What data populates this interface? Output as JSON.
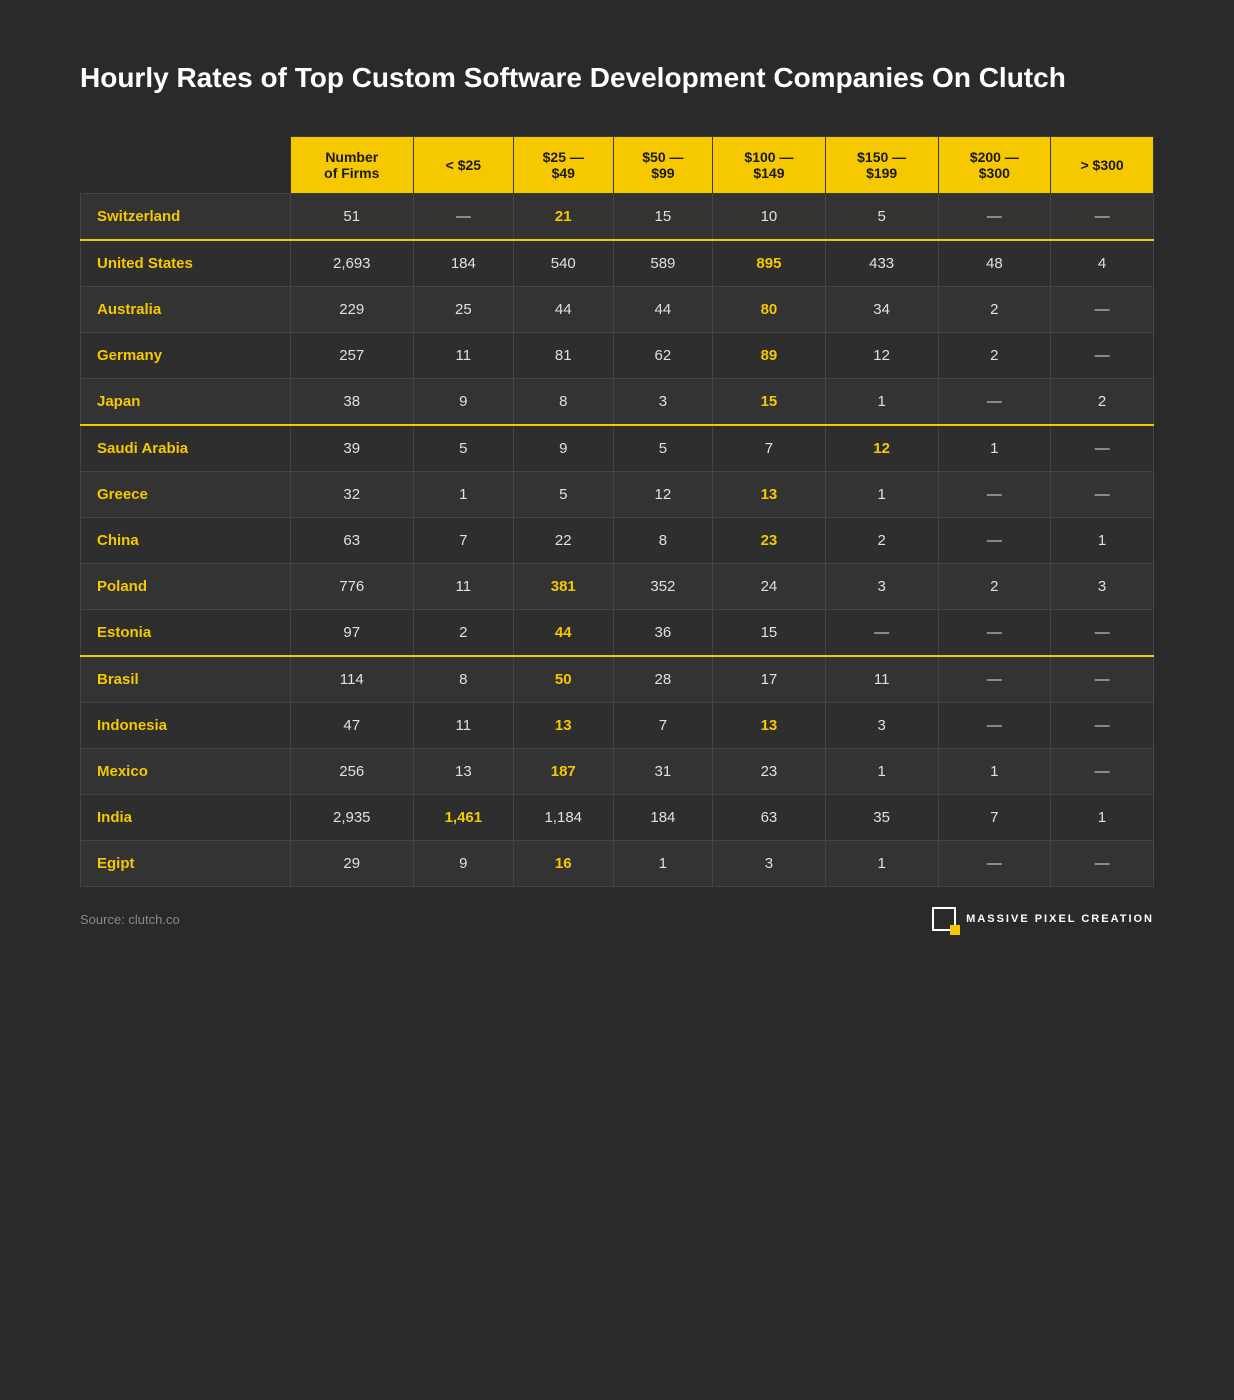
{
  "title": "Hourly Rates of Top Custom Software Development Companies On Clutch",
  "headers": [
    {
      "key": "country",
      "label": ""
    },
    {
      "key": "firms",
      "label": "Number of Firms"
    },
    {
      "key": "lt25",
      "label": "< $25"
    },
    {
      "key": "25to49",
      "label": "$25 — $49"
    },
    {
      "key": "50to99",
      "label": "$50 — $99"
    },
    {
      "key": "100to149",
      "label": "$100 — $149"
    },
    {
      "key": "150to199",
      "label": "$150 — $199"
    },
    {
      "key": "200to300",
      "label": "$200 — $300"
    },
    {
      "key": "gt300",
      "label": "> $300"
    }
  ],
  "rows": [
    {
      "country": "Switzerland",
      "firms": "51",
      "lt25": "—",
      "25to49": "21",
      "50to99": "15",
      "100to149": "10",
      "150to199": "5",
      "200to300": "—",
      "gt300": "—",
      "bold": "25to49",
      "separator": true
    },
    {
      "country": "United States",
      "firms": "2,693",
      "lt25": "184",
      "25to49": "540",
      "50to99": "589",
      "100to149": "895",
      "150to199": "433",
      "200to300": "48",
      "gt300": "4",
      "bold": "100to149",
      "separator": false
    },
    {
      "country": "Australia",
      "firms": "229",
      "lt25": "25",
      "25to49": "44",
      "50to99": "44",
      "100to149": "80",
      "150to199": "34",
      "200to300": "2",
      "gt300": "—",
      "bold": "100to149",
      "separator": false
    },
    {
      "country": "Germany",
      "firms": "257",
      "lt25": "11",
      "25to49": "81",
      "50to99": "62",
      "100to149": "89",
      "150to199": "12",
      "200to300": "2",
      "gt300": "—",
      "bold": "100to149",
      "separator": false
    },
    {
      "country": "Japan",
      "firms": "38",
      "lt25": "9",
      "25to49": "8",
      "50to99": "3",
      "100to149": "15",
      "150to199": "1",
      "200to300": "—",
      "gt300": "2",
      "bold": "100to149",
      "separator": true
    },
    {
      "country": "Saudi Arabia",
      "firms": "39",
      "lt25": "5",
      "25to49": "9",
      "50to99": "5",
      "100to149": "7",
      "150to199": "12",
      "200to300": "1",
      "gt300": "—",
      "bold": "150to199",
      "separator": false
    },
    {
      "country": "Greece",
      "firms": "32",
      "lt25": "1",
      "25to49": "5",
      "50to99": "12",
      "100to149": "13",
      "150to199": "1",
      "200to300": "—",
      "gt300": "—",
      "bold": "100to149",
      "separator": false
    },
    {
      "country": "China",
      "firms": "63",
      "lt25": "7",
      "25to49": "22",
      "50to99": "8",
      "100to149": "23",
      "150to199": "2",
      "200to300": "—",
      "gt300": "1",
      "bold": "100to149",
      "separator": false
    },
    {
      "country": "Poland",
      "firms": "776",
      "lt25": "11",
      "25to49": "381",
      "50to99": "352",
      "100to149": "24",
      "150to199": "3",
      "200to300": "2",
      "gt300": "3",
      "bold": "25to49",
      "separator": false
    },
    {
      "country": "Estonia",
      "firms": "97",
      "lt25": "2",
      "25to49": "44",
      "50to99": "36",
      "100to149": "15",
      "150to199": "—",
      "200to300": "—",
      "gt300": "—",
      "bold": "25to49",
      "separator": true
    },
    {
      "country": "Brasil",
      "firms": "114",
      "lt25": "8",
      "25to49": "50",
      "50to99": "28",
      "100to149": "17",
      "150to199": "11",
      "200to300": "—",
      "gt300": "—",
      "bold": "25to49",
      "separator": false
    },
    {
      "country": "Indonesia",
      "firms": "47",
      "lt25": "11",
      "25to49": "13",
      "50to99": "7",
      "100to149": "13",
      "150to199": "3",
      "200to300": "—",
      "gt300": "—",
      "bold": "25to49,100to149",
      "separator": false
    },
    {
      "country": "Mexico",
      "firms": "256",
      "lt25": "13",
      "25to49": "187",
      "50to99": "31",
      "100to149": "23",
      "150to199": "1",
      "200to300": "1",
      "gt300": "—",
      "bold": "25to49",
      "separator": false
    },
    {
      "country": "India",
      "firms": "2,935",
      "lt25": "1,461",
      "25to49": "1,184",
      "50to99": "184",
      "100to149": "63",
      "150to199": "35",
      "200to300": "7",
      "gt300": "1",
      "bold": "lt25",
      "separator": false
    },
    {
      "country": "Egipt",
      "firms": "29",
      "lt25": "9",
      "25to49": "16",
      "50to99": "1",
      "100to149": "3",
      "150to199": "1",
      "200to300": "—",
      "gt300": "—",
      "bold": "25to49",
      "separator": false
    }
  ],
  "footer": {
    "source": "Source: clutch.co",
    "logo_text": "MASSIVE PIXEL CREATION"
  }
}
